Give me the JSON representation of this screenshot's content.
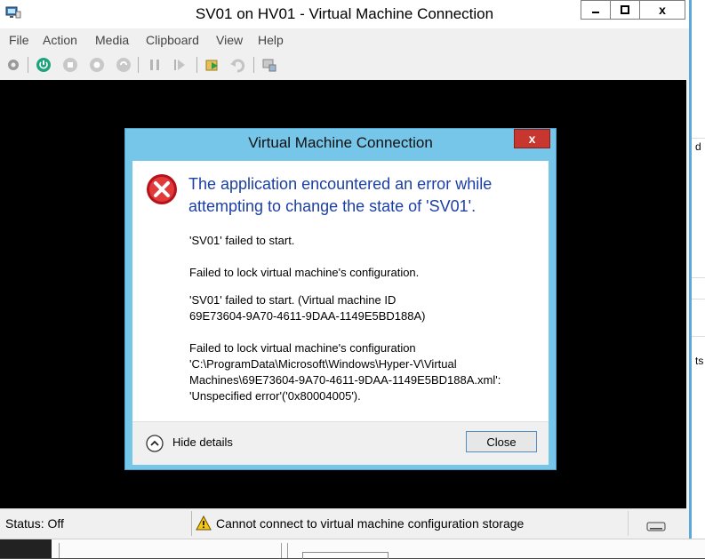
{
  "window": {
    "title": "SV01 on HV01 - Virtual Machine Connection",
    "min_label": "▁",
    "max_label": "☐",
    "close_label": "x"
  },
  "menu": [
    "File",
    "Action",
    "Media",
    "Clipboard",
    "View",
    "Help"
  ],
  "toolbar": {
    "icons": [
      "ctrl-alt-del-icon",
      "start-icon",
      "turn-off-icon",
      "shut-down-icon",
      "save-icon",
      "pause-icon",
      "reset-icon",
      "checkpoint-icon",
      "revert-icon",
      "enhanced-session-icon"
    ]
  },
  "dialog": {
    "title": "Virtual Machine Connection",
    "close_label": "x",
    "headline": "The application encountered an error while attempting to change the state of 'SV01'.",
    "messages": [
      "'SV01' failed to start.",
      "Failed to lock virtual machine's configuration.",
      "'SV01' failed to start. (Virtual machine ID 69E73604-9A70-4611-9DAA-1149E5BD188A)",
      "Failed to lock virtual machine's configuration 'C:\\ProgramData\\Microsoft\\Windows\\Hyper-V\\Virtual Machines\\69E73604-9A70-4611-9DAA-1149E5BD188A.xml': 'Unspecified error'('0x80004005')."
    ],
    "hide_details": "Hide details",
    "close_button": "Close"
  },
  "status": {
    "left": "Status: Off",
    "message": "Cannot connect to virtual machine configuration storage"
  },
  "background": {
    "snippet_1": "d",
    "snippet_2": "ts"
  },
  "colors": {
    "dialog_frame": "#76c6ea",
    "headline": "#1c3fa6",
    "close_red": "#c7372f",
    "accent_blue": "#5aa9d6"
  }
}
